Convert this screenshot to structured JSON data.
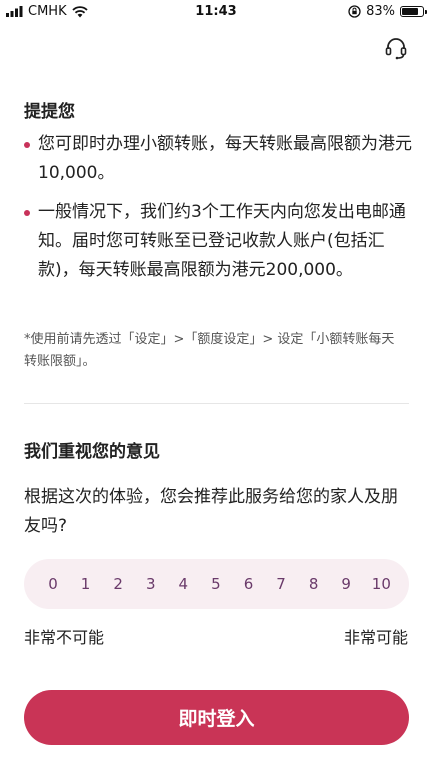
{
  "status_bar": {
    "carrier": "CMHK",
    "time": "11:43",
    "battery": "83%",
    "battery_level": 0.83
  },
  "header": {
    "support_icon": "headset-icon"
  },
  "tips": {
    "title": "提提您",
    "items": [
      "您可即时办理小额转账，每天转账最高限额为港元10,000。",
      "一般情况下，我们约3个工作天内向您发出电邮通知。届时您可转账至已登记收款人账户(包括汇款)，每天转账最高限额为港元200,000。"
    ],
    "note": "*使用前请先透过「设定」>「额度设定」> 设定「小额转账每天转账限额」。"
  },
  "feedback": {
    "title": "我们重视您的意见",
    "question": "根据这次的体验，您会推荐此服务给您的家人及朋友吗?",
    "scale": [
      "0",
      "1",
      "2",
      "3",
      "4",
      "5",
      "6",
      "7",
      "8",
      "9",
      "10"
    ],
    "low_label": "非常不可能",
    "high_label": "非常可能"
  },
  "login_button": "即时登入",
  "colors": {
    "accent": "#c93456",
    "scale_bg": "#f8eef2",
    "scale_text": "#6a3a6a"
  }
}
